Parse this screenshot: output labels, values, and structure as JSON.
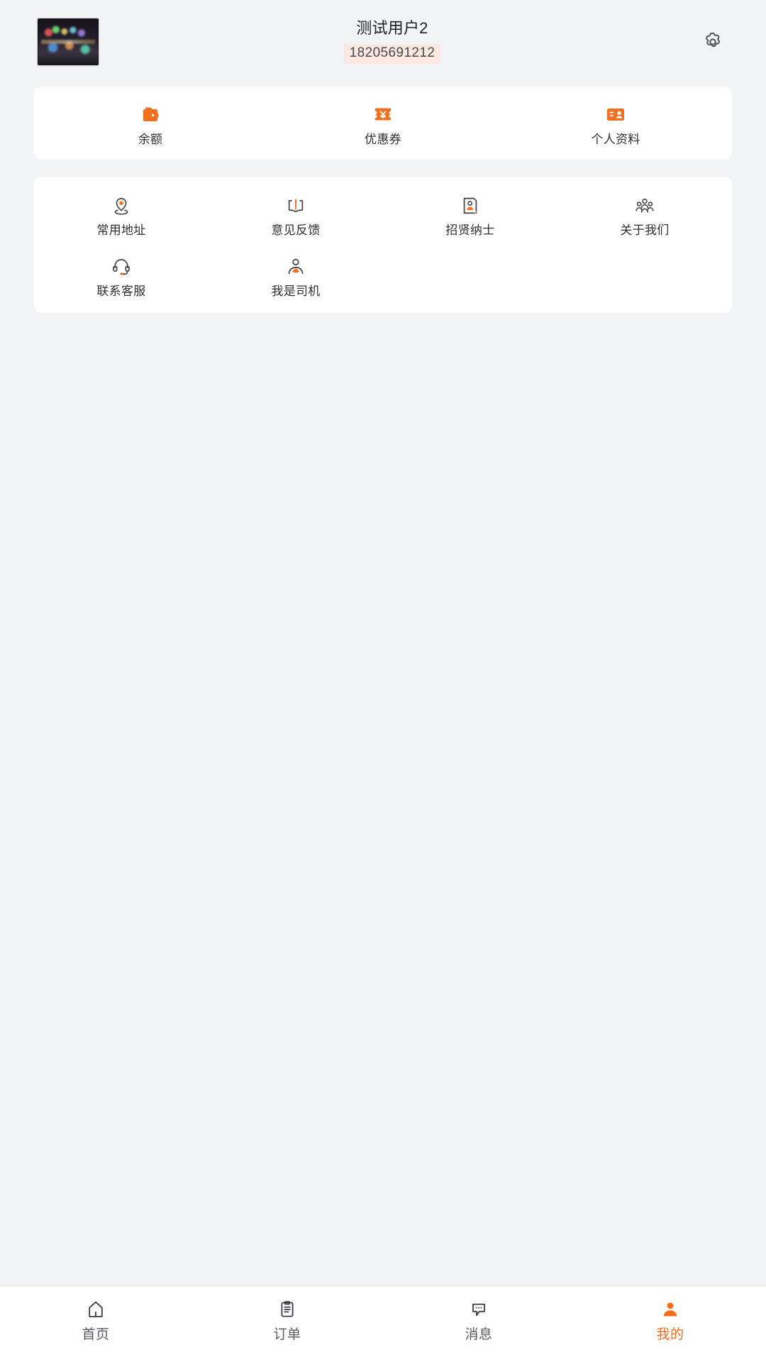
{
  "theme": {
    "accent": "#f37021",
    "accent_active": "#ff6b16",
    "page_bg": "#f2f3f5",
    "card_bg": "#ffffff",
    "text_primary": "#1f1f1f",
    "text_secondary": "#5a5a5e",
    "phone_badge_bg": "#fbe9e1"
  },
  "header": {
    "avatar_name": "user-avatar",
    "name": "测试用户2",
    "phone": "18205691212",
    "settings_icon": "gear-icon"
  },
  "quick_actions": [
    {
      "label": "余额",
      "icon": "wallet-icon"
    },
    {
      "label": "优惠券",
      "icon": "coupon-icon"
    },
    {
      "label": "个人资料",
      "icon": "id-card-icon"
    }
  ],
  "menu": [
    {
      "label": "常用地址",
      "icon": "location-pin-icon"
    },
    {
      "label": "意见反馈",
      "icon": "open-book-icon"
    },
    {
      "label": "招贤纳士",
      "icon": "recruit-card-icon"
    },
    {
      "label": "关于我们",
      "icon": "people-group-icon"
    },
    {
      "label": "联系客服",
      "icon": "headset-icon"
    },
    {
      "label": "我是司机",
      "icon": "driver-person-icon"
    }
  ],
  "tabbar": {
    "items": [
      {
        "label": "首页",
        "icon": "home-icon",
        "active": false
      },
      {
        "label": "订单",
        "icon": "clipboard-icon",
        "active": false
      },
      {
        "label": "消息",
        "icon": "chat-bubble-icon",
        "active": false
      },
      {
        "label": "我的",
        "icon": "person-icon",
        "active": true
      }
    ]
  }
}
